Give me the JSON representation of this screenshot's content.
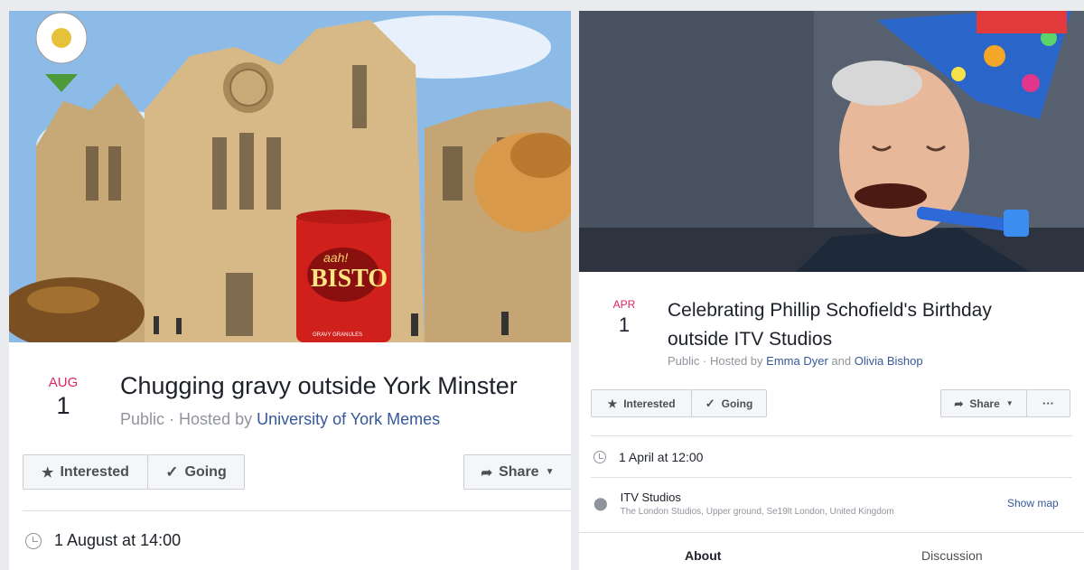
{
  "left_event": {
    "date_month": "AUG",
    "date_day": "1",
    "title": "Chugging gravy outside York Minster",
    "visibility": "Public",
    "hosted_prefix": "· Hosted by",
    "host": "University of York Memes",
    "interested_label": "Interested",
    "going_label": "Going",
    "share_label": "Share",
    "time": "1 August at 14:00",
    "cover_tin_text": "BISTO",
    "cover_tin_subtext": "aah!",
    "cover_tin_bottom": "GRAVY GRANULES"
  },
  "right_event": {
    "date_month": "APR",
    "date_day": "1",
    "title_line1": "Celebrating Phillip Schofield's Birthday",
    "title_line2": "outside ITV Studios",
    "visibility": "Public",
    "hosted_prefix": "· Hosted by",
    "host1": "Emma Dyer",
    "and_text": "and",
    "host2": "Olivia Bishop",
    "interested_label": "Interested",
    "going_label": "Going",
    "share_label": "Share",
    "more_label": "···",
    "time": "1 April at 12:00",
    "location_name": "ITV Studios",
    "location_address": "The London Studios, Upper ground, Se19lt London, United Kingdom",
    "show_map_label": "Show map",
    "tab_about": "About",
    "tab_discussion": "Discussion"
  },
  "colors": {
    "date_month": "#e0245e",
    "link": "#365899",
    "meta_text": "#90949c",
    "background": "#e9ebee"
  }
}
